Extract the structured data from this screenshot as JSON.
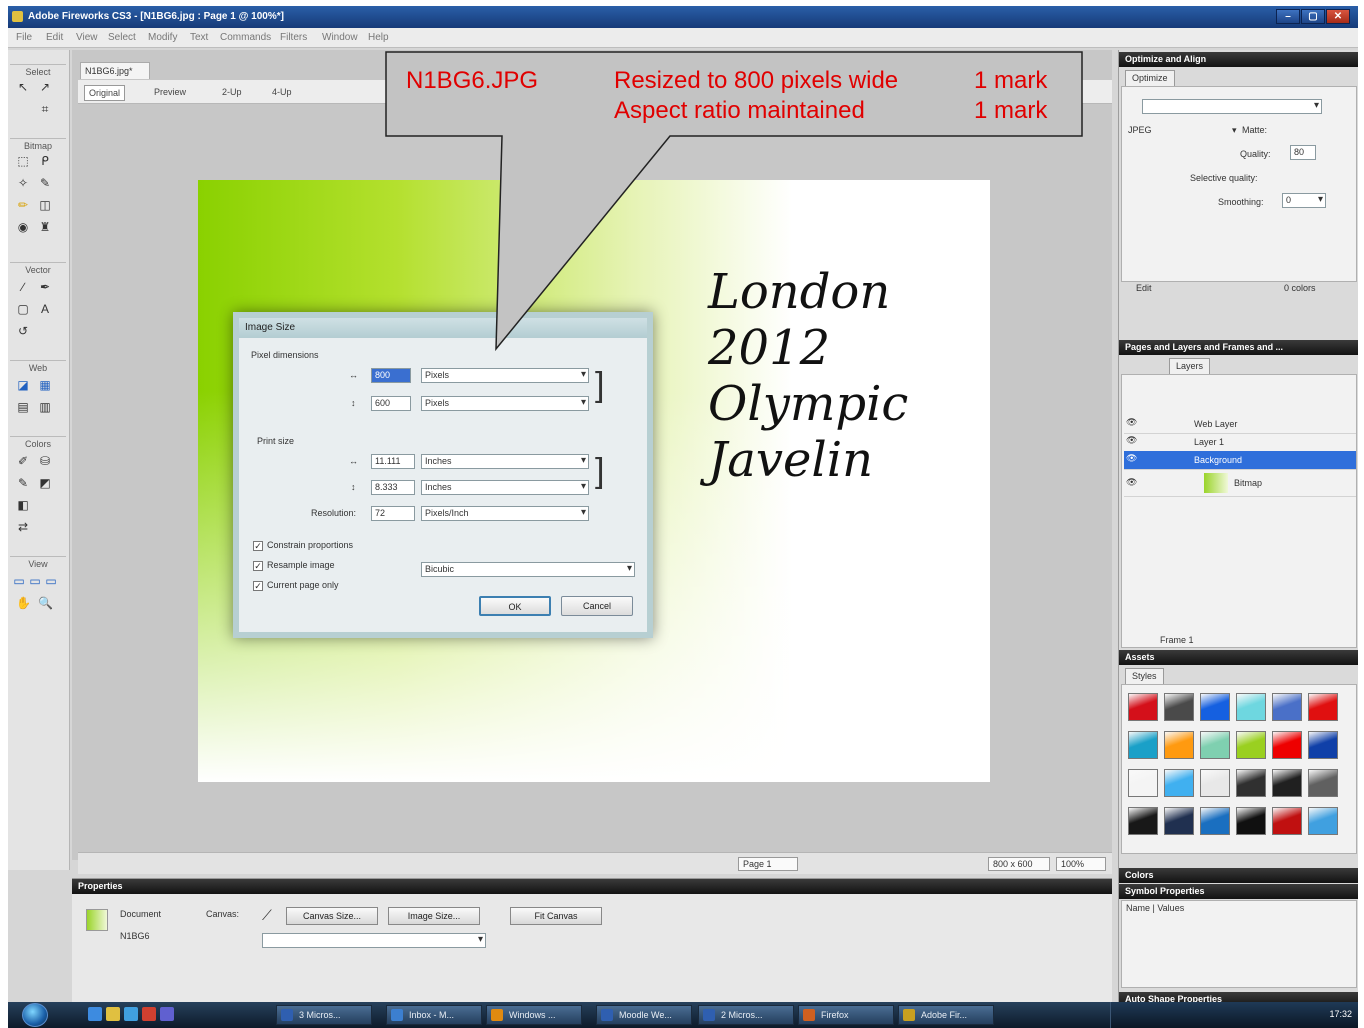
{
  "window": {
    "title": "Adobe Fireworks CS3 - [N1BG6.jpg : Page 1 @ 100%*]",
    "minimize": "–",
    "maximize": "▢",
    "close": "✕"
  },
  "menubar": [
    "File",
    "Edit",
    "View",
    "Select",
    "Modify",
    "Text",
    "Commands",
    "Filters",
    "Window",
    "Help"
  ],
  "tools": {
    "sections": [
      "Select",
      "Bitmap",
      "Vector",
      "Web",
      "Colors",
      "View"
    ]
  },
  "document": {
    "tab": "N1BG6.jpg*",
    "view_tabs": [
      "Original",
      "Preview",
      "2-Up",
      "4-Up"
    ],
    "headline": [
      "London",
      "2012",
      "Olympic",
      "Javelin"
    ]
  },
  "status": {
    "page": "Page 1",
    "size": "800 x 600",
    "zoom": "100%"
  },
  "dialog": {
    "title": "Image Size",
    "pixel_dimensions_label": "Pixel dimensions",
    "width_px": "800",
    "height_px": "600",
    "px_unit": "Pixels",
    "print_size_label": "Print size",
    "width_in": "11.111",
    "height_in": "8.333",
    "in_unit": "Inches",
    "resolution_label": "Resolution:",
    "resolution_value": "72",
    "resolution_unit": "Pixels/Inch",
    "constrain": "Constrain proportions",
    "resample": "Resample image",
    "resample_method": "Bicubic",
    "current_page": "Current page only",
    "ok": "OK",
    "cancel": "Cancel"
  },
  "callout": {
    "filename": "N1BG6.JPG",
    "line1": "Resized to 800 pixels wide",
    "line2": "Aspect ratio maintained",
    "mark1": "1 mark",
    "mark2": "1 mark",
    "text_color": "#e00000"
  },
  "panels": {
    "optimize": {
      "header": "Optimize and Align",
      "tab": "Optimize",
      "format": "JPEG",
      "matte_label": "Matte:",
      "quality_label": "Quality:",
      "quality_value": "80",
      "selective_label": "Selective quality:",
      "smoothing_label": "Smoothing:",
      "smoothing_value": "0",
      "saved_label": "Edit",
      "colors_label": "0 colors"
    },
    "layers": {
      "header": "Pages and Layers and Frames and ...",
      "tab": "Layers",
      "rows": [
        "Web Layer",
        "Layer 1",
        "Background",
        "Bitmap"
      ],
      "frame": "Frame 1"
    },
    "assets": {
      "header": "Assets",
      "tab": "Styles"
    },
    "colors_header": "Colors",
    "symbol": {
      "header": "Symbol Properties",
      "columns": "Name  |  Values"
    },
    "auto_shape": "Auto Shape Properties"
  },
  "properties": {
    "header": "Properties",
    "doc_label": "Document",
    "doc_name": "N1BG6",
    "canvas_label": "Canvas:",
    "canvas_size_btn": "Canvas Size...",
    "image_size_btn": "Image Size...",
    "fit_canvas_btn": "Fit Canvas"
  },
  "taskbar": {
    "tasks": [
      "3 Micros...",
      "Inbox - M...",
      "Windows ...",
      "Moodle We...",
      "2 Micros...",
      "Firefox",
      "Adobe Fir..."
    ],
    "clock": "17:32"
  },
  "swatch_colors": [
    "#d4101a",
    "#4a4a4a",
    "#1560e0",
    "#6ed7e0",
    "#4a70c8",
    "#e01010",
    "#1aa0c8",
    "#ff9a10",
    "#7fd0b0",
    "#9ad020",
    "#ee0000",
    "#1040a8",
    "#f4f4f4",
    "#40b0f0",
    "#e8e8e8",
    "#303030",
    "#202020",
    "#606060",
    "#181818",
    "#203050",
    "#1a6fc0",
    "#101010",
    "#c01010",
    "#40a0e0"
  ]
}
